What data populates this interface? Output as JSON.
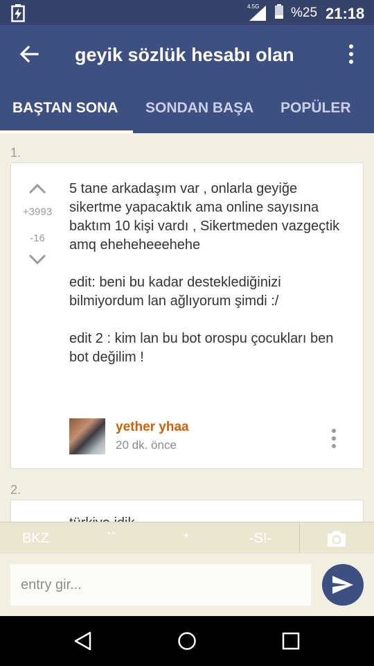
{
  "status_bar": {
    "network": "4.5G",
    "battery_percent": "%25",
    "time": "21:18",
    "icons": [
      "battery-charging-icon",
      "signal-icon",
      "battery-icon"
    ]
  },
  "app_bar": {
    "title": "geyik sözlük hesabı olan",
    "tabs": [
      {
        "label": "BAŞTAN SONA",
        "active": true
      },
      {
        "label": "SONDAN BAŞA",
        "active": false
      },
      {
        "label": "POPÜLER",
        "active": false
      }
    ]
  },
  "entries": [
    {
      "number": "1.",
      "upvotes": "+3993",
      "downvotes": "-16",
      "paragraphs": [
        "5 tane arkadaşım var , onlarla geyiğe sikertme yapacaktık ama online sayısına baktım 10 kişi vardı , Sikertmeden vazgeçtik amq eheheheeehehe",
        "edit: beni bu kadar desteklediğinizi bilmiyordum lan ağlıyorum şimdi :/",
        "edit 2 : kim lan bu bot orospu çocukları ben bot değilim !"
      ],
      "author": "yether yhaa",
      "time": "20 dk. önce"
    },
    {
      "number": "2.",
      "partial_text": "türkiye idik..."
    }
  ],
  "toolbar": {
    "bkz": "BKZ",
    "backtick": "``",
    "star": "*",
    "spoiler": "-S!-",
    "camera_icon": "camera-icon"
  },
  "input": {
    "placeholder": "entry gir..."
  },
  "colors": {
    "primary": "#3e5081",
    "status_bar": "#35436a",
    "background": "#f1eee2",
    "author": "#c8610a"
  }
}
